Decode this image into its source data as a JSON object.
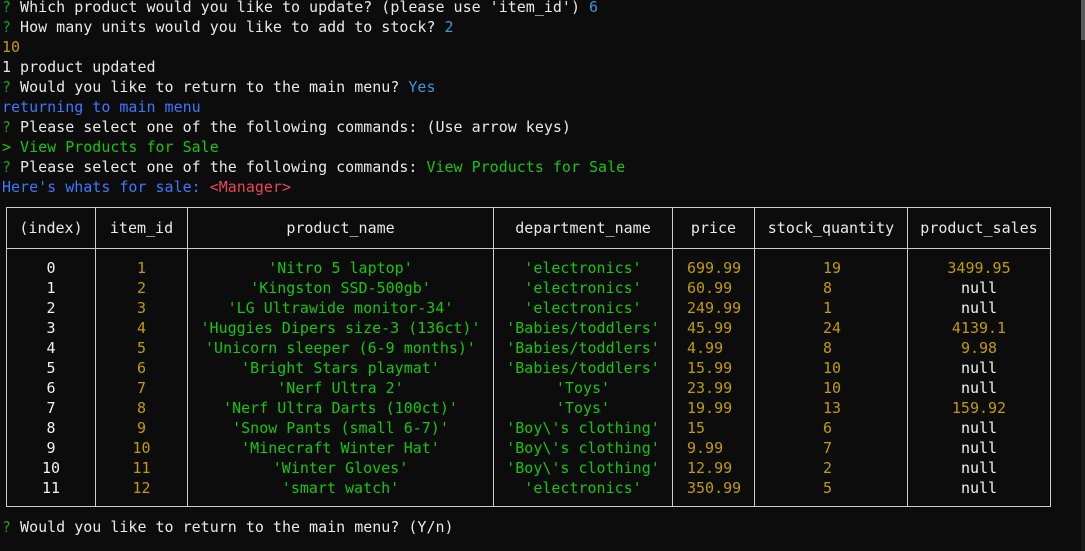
{
  "lines": {
    "l1": {
      "mark": "?",
      "text": " Which product would you like to update? (please use 'item_id') ",
      "answer": "6"
    },
    "l2": {
      "mark": "?",
      "text": " How many units would you like to add to stock? ",
      "answer": "2"
    },
    "l3": {
      "text": "10"
    },
    "l4": {
      "text": "1 product updated"
    },
    "l5": {
      "mark": "?",
      "text": " Would you like to return to the main menu? ",
      "answer": "Yes"
    },
    "l6": {
      "text": "returning to main menu"
    },
    "l7": {
      "mark": "?",
      "text": " Please select one of the following commands: (Use arrow keys)"
    },
    "l8": {
      "text": "> View Products for Sale"
    },
    "l9": {
      "mark": "?",
      "text": " Please select one of the following commands: ",
      "answer": "View Products for Sale"
    },
    "l10": {
      "text": "Here's whats for sale: ",
      "role": "<Manager>"
    },
    "l11": {
      "mark": "?",
      "text": " Would you like to return to the main menu? (Y/n)"
    }
  },
  "table": {
    "headers": [
      "(index)",
      "item_id",
      "product_name",
      "department_name",
      "price",
      "stock_quantity",
      "product_sales"
    ],
    "rows": [
      [
        "0",
        "1",
        "'Nitro 5 laptop'",
        "'electronics'",
        "699.99",
        "19",
        "3499.95"
      ],
      [
        "1",
        "2",
        "'Kingston SSD-500gb'",
        "'electronics'",
        "60.99",
        "8",
        "null"
      ],
      [
        "2",
        "3",
        "'LG Ultrawide monitor-34'",
        "'electronics'",
        "249.99",
        "1",
        "null"
      ],
      [
        "3",
        "4",
        "'Huggies Dipers size-3 (136ct)'",
        "'Babies/toddlers'",
        "45.99",
        "24",
        "4139.1"
      ],
      [
        "4",
        "5",
        "'Unicorn sleeper (6-9 months)'",
        "'Babies/toddlers'",
        "4.99",
        "8",
        "9.98"
      ],
      [
        "5",
        "6",
        "'Bright Stars playmat'",
        "'Babies/toddlers'",
        "15.99",
        "10",
        "null"
      ],
      [
        "6",
        "7",
        "'Nerf Ultra 2'",
        "'Toys'",
        "23.99",
        "10",
        "null"
      ],
      [
        "7",
        "8",
        "'Nerf Ultra Darts (100ct)'",
        "'Toys'",
        "19.99",
        "13",
        "159.92"
      ],
      [
        "8",
        "9",
        "'Snow Pants (small 6-7)'",
        "'Boy\\'s clothing'",
        "15",
        "6",
        "null"
      ],
      [
        "9",
        "10",
        "'Minecraft Winter Hat'",
        "'Boy\\'s clothing'",
        "9.99",
        "7",
        "null"
      ],
      [
        "10",
        "11",
        "'Winter Gloves'",
        "'Boy\\'s clothing'",
        "12.99",
        "2",
        "null"
      ],
      [
        "11",
        "12",
        "'smart watch'",
        "'electronics'",
        "350.99",
        "5",
        "null"
      ]
    ]
  },
  "colors": {
    "background": "#0c0c0c",
    "prompt_mark": "#13a10e",
    "answer": "#3a96dd",
    "number": "#c19c00",
    "string": "#16c60c",
    "info": "#3b78ff",
    "role": "#e74856",
    "text": "#e8e8e8"
  }
}
